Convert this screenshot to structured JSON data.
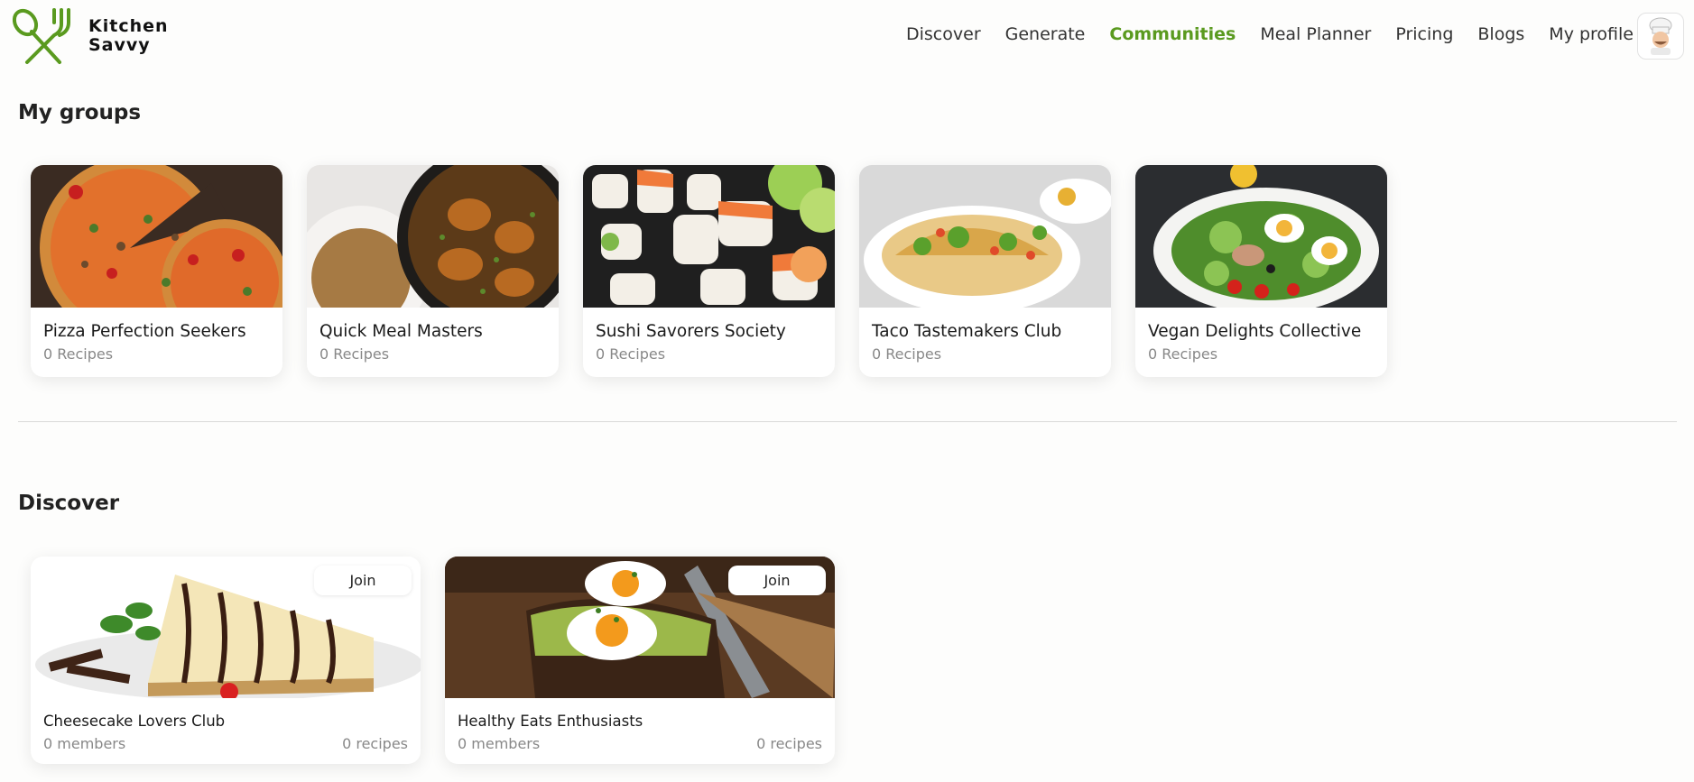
{
  "brand": {
    "name_line1": "Kitchen",
    "name_line2": "Savvy",
    "accent": "#5a9a1f"
  },
  "nav": {
    "items": [
      {
        "label": "Discover"
      },
      {
        "label": "Generate"
      },
      {
        "label": "Communities",
        "active": true
      },
      {
        "label": "Meal Planner"
      },
      {
        "label": "Pricing"
      },
      {
        "label": "Blogs"
      },
      {
        "label": "My profile"
      }
    ]
  },
  "my_groups": {
    "title": "My groups",
    "cards": [
      {
        "name": "Pizza Perfection Seekers",
        "recipes": "0 Recipes",
        "image": "pizza"
      },
      {
        "name": "Quick Meal Masters",
        "recipes": "0 Recipes",
        "image": "chicken-skillet"
      },
      {
        "name": "Sushi Savorers Society",
        "recipes": "0 Recipes",
        "image": "sushi"
      },
      {
        "name": "Taco Tastemakers Club",
        "recipes": "0 Recipes",
        "image": "tacos"
      },
      {
        "name": "Vegan Delights Collective",
        "recipes": "0 Recipes",
        "image": "salad"
      }
    ]
  },
  "discover": {
    "title": "Discover",
    "cards": [
      {
        "name": "Cheesecake Lovers Club",
        "members": "0 members",
        "recipes": "0 recipes",
        "join_label": "Join",
        "image": "cheesecake"
      },
      {
        "name": "Healthy Eats Enthusiasts",
        "members": "0 members",
        "recipes": "0 recipes",
        "join_label": "Join",
        "image": "avocado-toast"
      }
    ]
  }
}
